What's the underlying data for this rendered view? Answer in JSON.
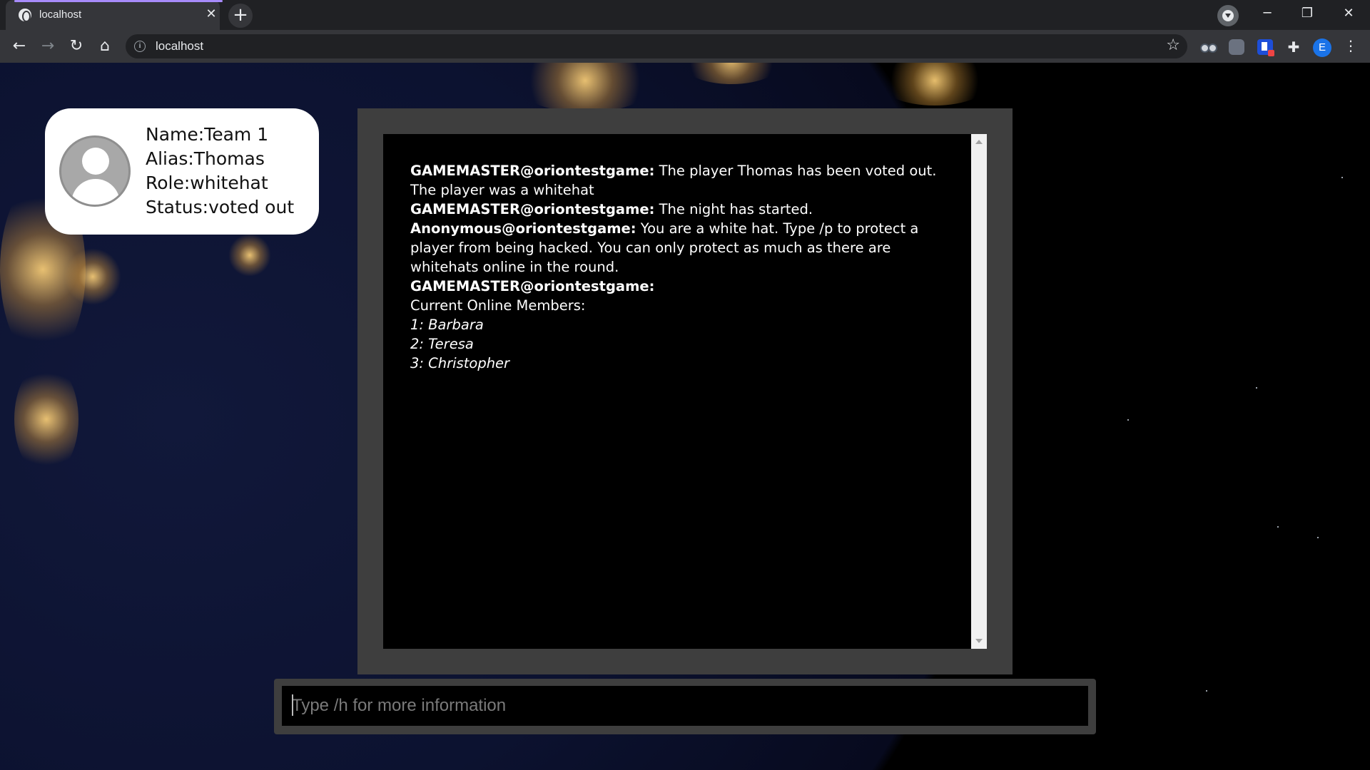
{
  "browser": {
    "tab_title": "localhost",
    "tab_close": "✕",
    "new_tab": "+",
    "url": "localhost",
    "window_controls": {
      "minimize": "─",
      "restore": "❐",
      "close": "✕"
    },
    "profile_initial": "E",
    "nav": {
      "back": "←",
      "forward": "→",
      "reload": "↻",
      "home": "⌂"
    },
    "star": "☆",
    "menu": "⋮",
    "puzzle": "✚",
    "info": "i",
    "extensions": [
      "glasses-extension-icon",
      "grey-extension-icon",
      "blue-extension-icon",
      "puzzle-icon"
    ]
  },
  "profile": {
    "name": "Name:Team 1",
    "alias": "Alias:Thomas",
    "role": "Role:whitehat",
    "status": "Status:voted out"
  },
  "chat": {
    "messages": [
      {
        "sender": "GAMEMASTER@oriontestgame:",
        "text": " The player Thomas has been voted out. The player was a whitehat"
      },
      {
        "sender": "GAMEMASTER@oriontestgame:",
        "text": " The night has started."
      },
      {
        "sender": "Anonymous@oriontestgame:",
        "text": " You are a white hat. Type /p to protect a player from being hacked. You can only protect as much as there are whitehats online in the round."
      },
      {
        "sender": "GAMEMASTER@oriontestgame:",
        "text": ""
      }
    ],
    "online_heading": "Current Online Members:",
    "members": [
      "1: Barbara",
      "2: Teresa",
      "3: Christopher"
    ]
  },
  "input": {
    "placeholder": "Type /h for more information",
    "value": ""
  },
  "colors": {
    "chat_frame": "#3e3e3e",
    "chat_bg": "#000000",
    "card_bg": "#ffffff",
    "tab_accent": "#a78bfa"
  }
}
